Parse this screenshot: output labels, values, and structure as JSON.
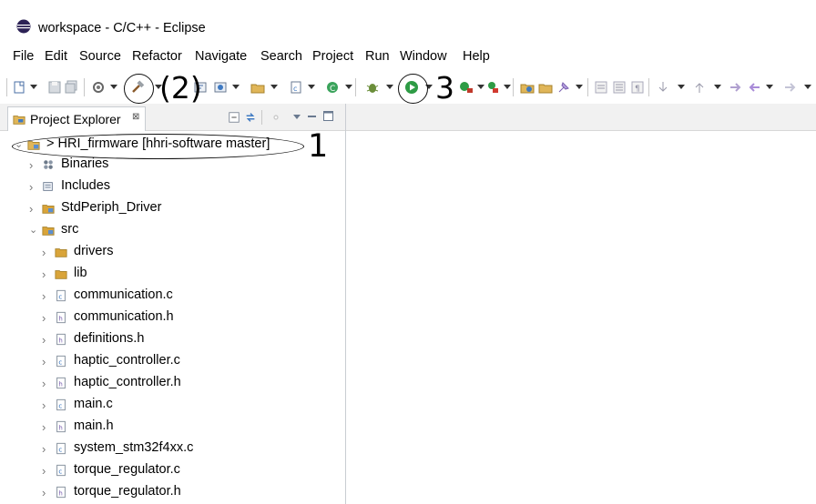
{
  "window": {
    "title": "workspace - C/C++ - Eclipse"
  },
  "menu": [
    "File",
    "Edit",
    "Source",
    "Refactor",
    "Navigate",
    "Search",
    "Project",
    "Run",
    "Window",
    "Help"
  ],
  "annotations": {
    "n1": "1",
    "n2": "(2)",
    "n3": "3"
  },
  "explorer": {
    "tab_label": "Project Explorer",
    "tab_close": "⊠",
    "project": "> HRI_firmware [hhri-software master]",
    "items": [
      {
        "label": "Binaries",
        "icon": "binaries-icon",
        "expanded": false
      },
      {
        "label": "Includes",
        "icon": "includes-icon",
        "expanded": false
      },
      {
        "label": "StdPeriph_Driver",
        "icon": "source-folder-icon",
        "expanded": false
      },
      {
        "label": "src",
        "icon": "source-folder-icon",
        "expanded": true
      },
      {
        "label": "drivers",
        "icon": "folder-icon",
        "expanded": false
      },
      {
        "label": "lib",
        "icon": "folder-icon",
        "expanded": false
      },
      {
        "label": "communication.c",
        "icon": "c-file-icon",
        "expanded": false
      },
      {
        "label": "communication.h",
        "icon": "h-file-icon",
        "expanded": false
      },
      {
        "label": "definitions.h",
        "icon": "h-file-icon",
        "expanded": false
      },
      {
        "label": "haptic_controller.c",
        "icon": "c-file-icon",
        "expanded": false
      },
      {
        "label": "haptic_controller.h",
        "icon": "h-file-icon",
        "expanded": false
      },
      {
        "label": "main.c",
        "icon": "c-file-icon",
        "expanded": false
      },
      {
        "label": "main.h",
        "icon": "h-file-icon",
        "expanded": false
      },
      {
        "label": "system_stm32f4xx.c",
        "icon": "c-file-icon",
        "expanded": false
      },
      {
        "label": "torque_regulator.c",
        "icon": "c-file-icon",
        "expanded": false
      },
      {
        "label": "torque_regulator.h",
        "icon": "h-file-icon",
        "expanded": false
      }
    ]
  },
  "colors": {
    "annotation": "#000000",
    "accent": "#2c6fbf",
    "folder": "#d9a43a"
  }
}
